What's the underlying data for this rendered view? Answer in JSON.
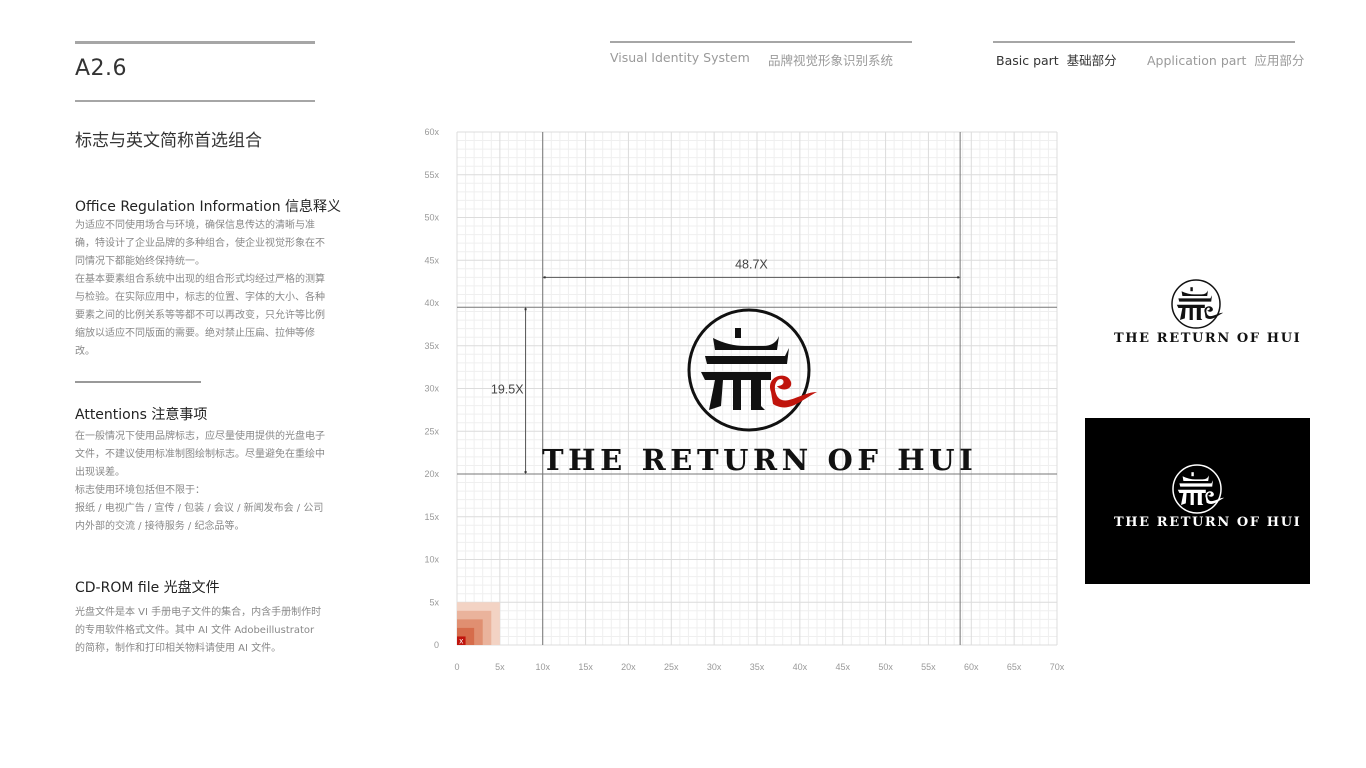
{
  "header": {
    "page_code": "A2.6",
    "page_subtitle": "标志与英文简称首选组合",
    "nav_system_en": "Visual Identity System",
    "nav_system_cn": "品牌视觉形象识别系统",
    "nav_basic": "Basic part  基础部分",
    "nav_application": "Application part  应用部分"
  },
  "sections": [
    {
      "title": "Office Regulation Information 信息释义",
      "paragraphs": [
        "为适应不同使用场合与环境，确保信息传达的清晰与准确，特设计了企业品牌的多种组合，使企业视觉形象在不同情况下都能始终保持统一。",
        "在基本要素组合系统中出现的组合形式均经过严格的测算与检验。在实际应用中，标志的位置、字体的大小、各种要素之间的比例关系等等都不可以再改变，只允许等比例缩放以适应不同版面的需要。绝对禁止压扁、拉伸等修改。"
      ]
    },
    {
      "title": "Attentions 注意事项",
      "paragraphs": [
        "在一般情况下使用品牌标志，应尽量使用提供的光盘电子文件，不建议使用标准制图绘制标志。尽量避免在重绘中出现误差。",
        "标志使用环境包括但不限于：",
        "报纸 / 电视广告 / 宣传 / 包装 / 会议 / 新闻发布会 / 公司内外部的交流 / 接待服务 / 纪念品等。"
      ]
    },
    {
      "title": "CD-ROM file 光盘文件",
      "paragraphs": [
        "光盘文件是本 VI 手册电子文件的集合，内含手册制作时的专用软件格式文件。其中 AI 文件 Adobeillustrator 的简称，制作和打印相关物料请使用 AI 文件。"
      ]
    }
  ],
  "grid": {
    "unit_marker": "x",
    "x_ticks": [
      "0",
      "5x",
      "10x",
      "15x",
      "20x",
      "25x",
      "30x",
      "35x",
      "40x",
      "45x",
      "50x",
      "55x",
      "60x",
      "65x",
      "70x"
    ],
    "y_ticks": [
      "0",
      "5x",
      "10x",
      "15x",
      "20x",
      "25x",
      "30x",
      "35x",
      "40x",
      "45x",
      "50x",
      "55x",
      "60x"
    ],
    "x_range": [
      0,
      70
    ],
    "y_range": [
      0,
      60
    ],
    "guides": {
      "left_x": 10,
      "right_x": 58.7,
      "top_y": 39.5,
      "bottom_y": 20
    },
    "width_dimension": {
      "label": "48.7X",
      "value": 48.7
    },
    "height_dimension": {
      "label": "19.5X",
      "value": 19.5
    },
    "unit_squares_colors": [
      "#f3d3c4",
      "#eab39c",
      "#e08f71",
      "#d66c4b",
      "#c0140c"
    ]
  },
  "logo": {
    "wordmark": "THE RETURN OF HUI",
    "primary_color": "#111111",
    "accent_color": "#c0140c"
  },
  "variants": {
    "white_background": {
      "wordmark": "THE RETURN OF HUI"
    },
    "black_background": {
      "wordmark": "THE RETURN OF HUI",
      "background": "#000000"
    }
  }
}
